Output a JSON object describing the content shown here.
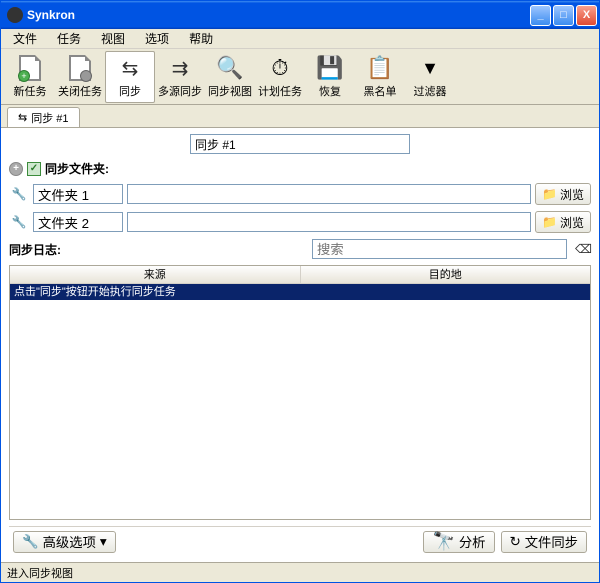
{
  "window": {
    "title": "Synkron"
  },
  "menu": {
    "file": "文件",
    "tasks": "任务",
    "view": "视图",
    "options": "选项",
    "help": "帮助"
  },
  "toolbar": {
    "new_task": "新任务",
    "close_task": "关闭任务",
    "sync": "同步",
    "multisync": "多源同步",
    "sync_view": "同步视图",
    "scheduled": "计划任务",
    "restore": "恢复",
    "blacklist": "黑名单",
    "filter": "过滤器"
  },
  "tab": {
    "label": "同步 #1",
    "name_value": "同步 #1"
  },
  "folders": {
    "header": "同步文件夹:",
    "row1_label": "文件夹 1",
    "row1_path": "",
    "row2_label": "文件夹 2",
    "row2_path": "",
    "browse": "浏览"
  },
  "log": {
    "title": "同步日志:",
    "search_placeholder": "搜索",
    "col_source": "来源",
    "col_dest": "目的地",
    "hint": "点击\"同步\"按钮开始执行同步任务"
  },
  "bottom": {
    "advanced": "高级选项",
    "analyse": "分析",
    "file_sync": "文件同步"
  },
  "status": {
    "text": "进入同步视图"
  }
}
